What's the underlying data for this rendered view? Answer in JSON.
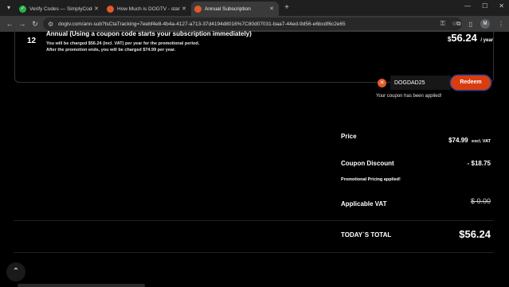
{
  "browser": {
    "tabs": [
      {
        "title": "Verify Codes — SimplyCodes",
        "icon": "simplycodes-favicon",
        "active": false
      },
      {
        "title": "How Much is DOGTV - start wi...",
        "icon": "dogtv-favicon",
        "active": false
      },
      {
        "title": "Annual Subscription",
        "icon": "dogtv-favicon",
        "active": true
      }
    ],
    "url": "dogtv.com/ann-sub?tsCtaTracking=7eebf4e8-4b4a-4127-a713-37d4194d8016%7C80d07031-baa7-44ed-9d56-e6bcdf6c2e65",
    "profile_initial": "M"
  },
  "plan": {
    "number": "12",
    "title": "Annual (Using a coupon code starts your subscription immediately)",
    "line1": "You will be charged $56.24 (incl. VAT) per year for the promotional period.",
    "line2": "After the promotion ends, you will be charged $74.99 per year.",
    "price_currency": "$",
    "price_amount": "56.24",
    "price_period": "/ year"
  },
  "coupon": {
    "code": "DOGDAD25",
    "button_label": "Redeem",
    "message": "Your coupon has been applied!"
  },
  "summary": {
    "price_label": "Price",
    "price_value": "$74.99",
    "price_suffix": "excl. VAT",
    "discount_label": "Coupon Discount",
    "discount_value": "- $18.75",
    "promo_note": "Promotional Pricing applied!",
    "vat_label": "Applicable VAT",
    "vat_value": "$ 0.00",
    "total_label": "TODAY`S TOTAL",
    "total_value": "$56.24"
  },
  "colors": {
    "accent": "#d93d0f",
    "background": "#000000"
  }
}
